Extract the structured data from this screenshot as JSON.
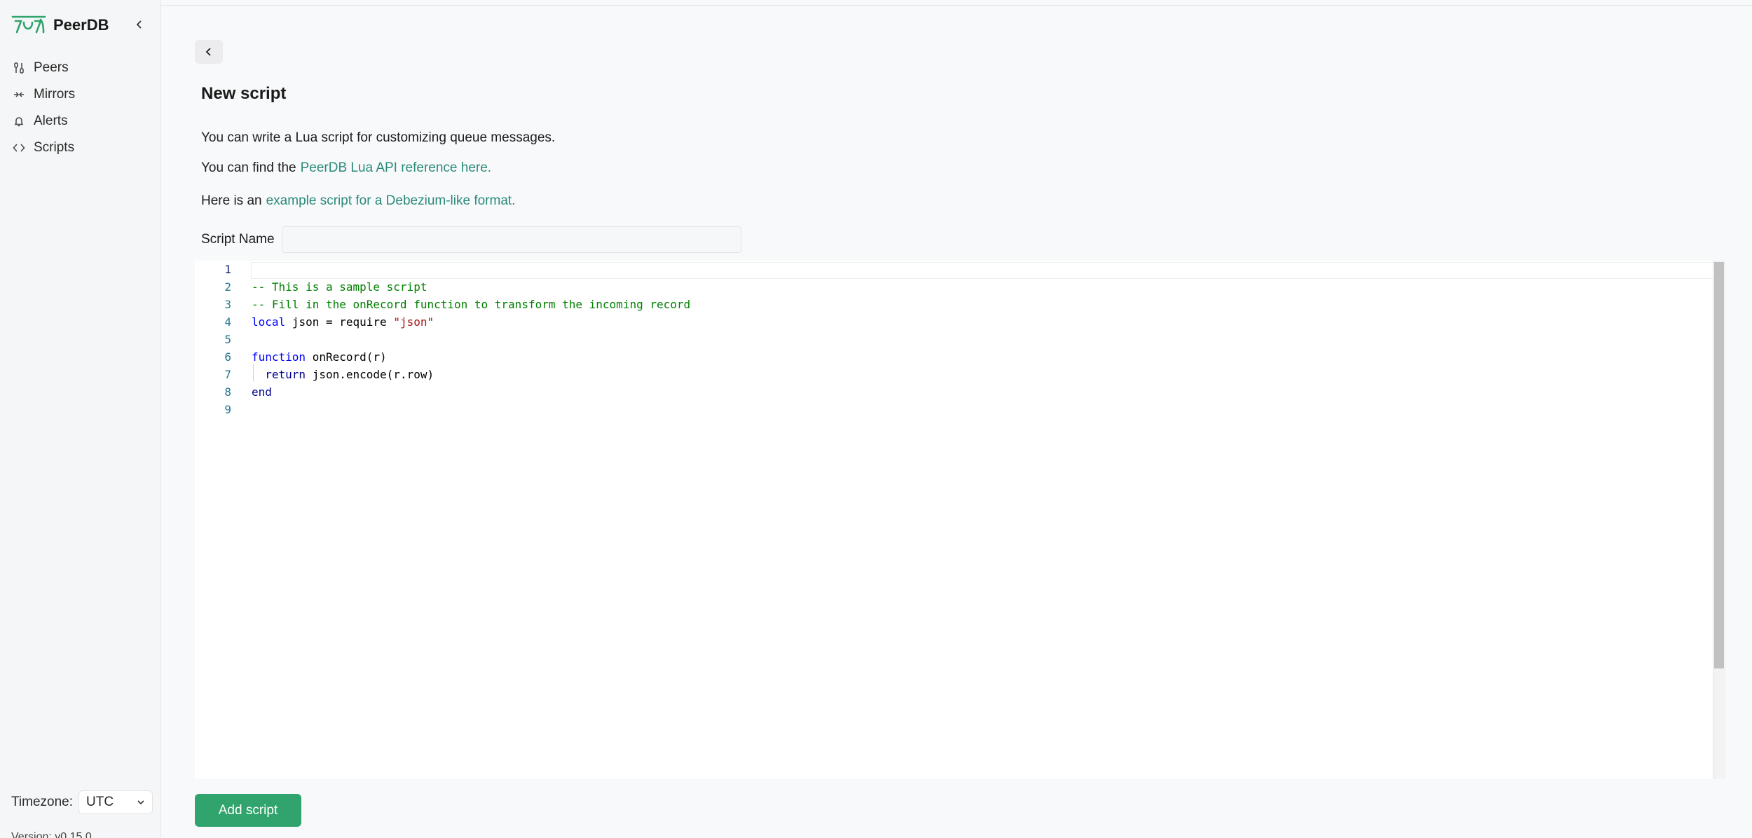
{
  "app": {
    "name": "PeerDB"
  },
  "sidebar": {
    "items": [
      {
        "label": "Peers",
        "icon": "peers-icon"
      },
      {
        "label": "Mirrors",
        "icon": "mirrors-icon"
      },
      {
        "label": "Alerts",
        "icon": "bell-icon"
      },
      {
        "label": "Scripts",
        "icon": "code-icon"
      }
    ],
    "timezone_label": "Timezone:",
    "timezone_value": "UTC",
    "version_text": "Version: v0.15.0"
  },
  "main": {
    "title": "New script",
    "intro": "You can write a Lua script for customizing queue messages.",
    "api_prefix": "You can find the",
    "api_link": "PeerDB Lua API reference here.",
    "example_prefix": "Here is an",
    "example_link": "example script for a Debezium-like format.",
    "script_name_label": "Script Name",
    "script_name_value": "",
    "add_button": "Add script"
  },
  "editor": {
    "line_numbers": [
      "1",
      "2",
      "3",
      "4",
      "5",
      "6",
      "7",
      "8",
      "9"
    ],
    "lines": [
      "",
      "-- This is a sample script",
      "-- Fill in the onRecord function to transform the incoming record",
      "local json = require \"json\"",
      "",
      "function onRecord(r)",
      "  return json.encode(r.row)",
      "end",
      ""
    ]
  },
  "colors": {
    "accent": "#30a46c",
    "link": "#2a8a7a",
    "comment": "#008000",
    "keyword": "#0000ff",
    "string": "#a31515"
  }
}
